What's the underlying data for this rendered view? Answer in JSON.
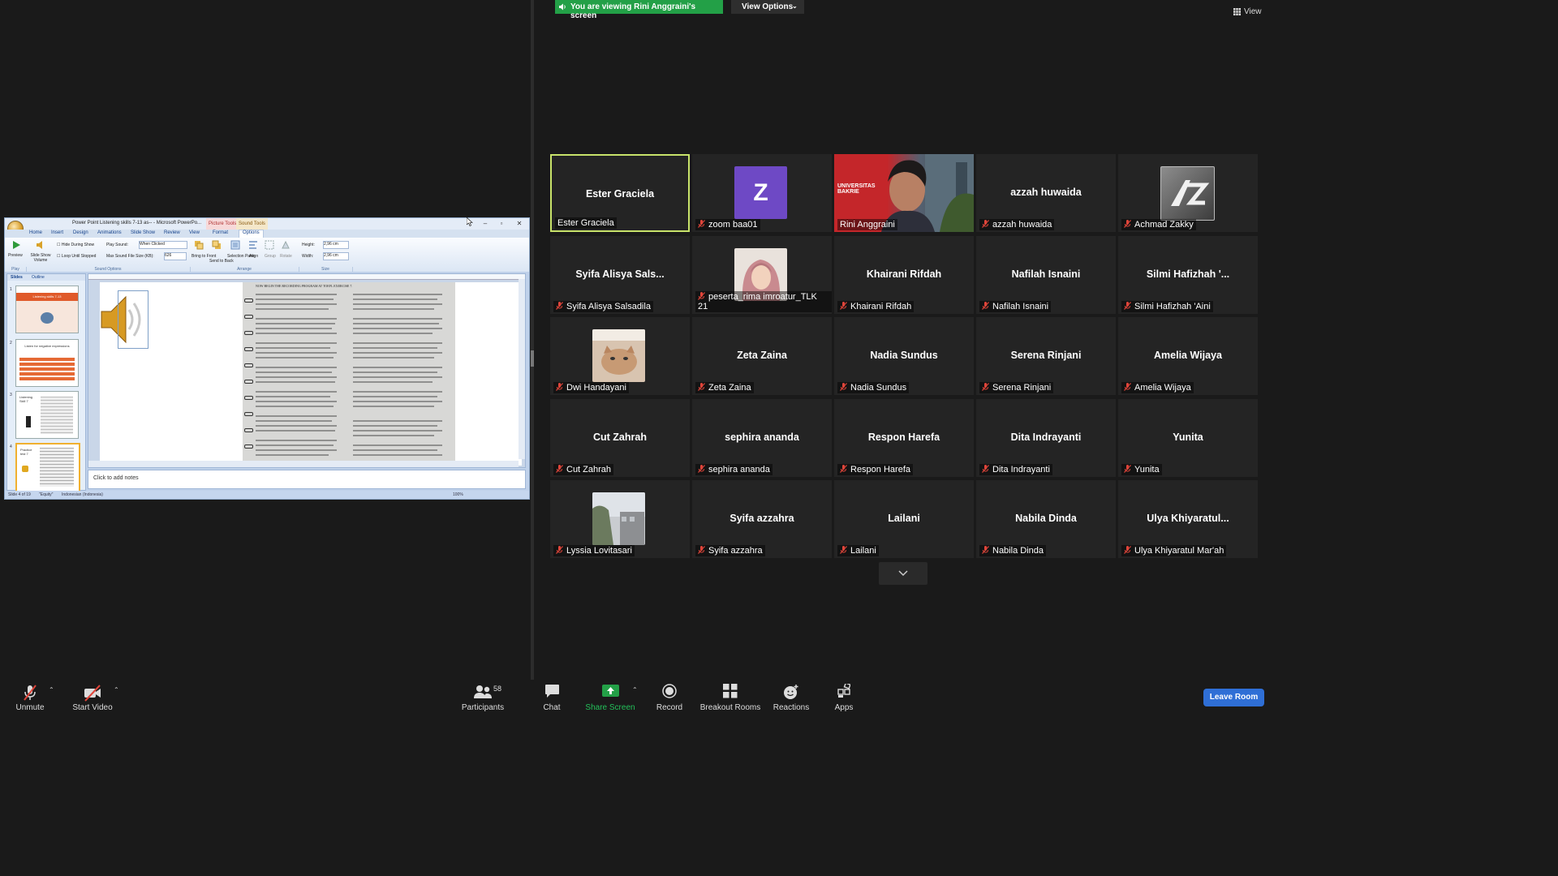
{
  "banner": {
    "text": "You are viewing Rini Anggraini's screen",
    "color": "#23a047"
  },
  "view_options": {
    "label": "View Options",
    "chevron": "⌄"
  },
  "view_button": {
    "label": "View"
  },
  "ppt": {
    "title": "Power Point Listening skills 7-13 as-- - Microsoft PowerPo...",
    "context_tab_1": "Picture Tools",
    "context_tab_2": "Sound Tools",
    "tabs": [
      "Home",
      "Insert",
      "Design",
      "Animations",
      "Slide Show",
      "Review",
      "View",
      "Format",
      "Options"
    ],
    "ribbon": {
      "preview": "Preview",
      "slideshow_volume": "Slide Show Volume",
      "hide_during_show": "Hide During Show",
      "loop_until_stopped": "Loop Until Stopped",
      "play_sound": "Play Sound:",
      "play_sound_value": "When Clicked",
      "max_sound_file_size": "Max Sound File Size (KB):",
      "max_sound_value": "626",
      "bring_to_front": "Bring to Front",
      "send_to_back": "Send to Back",
      "selection_pane": "Selection Pane",
      "align": "Align",
      "group": "Group",
      "rotate": "Rotate",
      "height": "Height:",
      "height_value": "2,96 cm",
      "width": "Width:",
      "width_value": "2,96 cm",
      "group_play": "Play",
      "group_sound_options": "Sound Options",
      "group_arrange": "Arrange",
      "group_size": "Size"
    },
    "panel_tabs": [
      "Slides",
      "Outline"
    ],
    "slide_numbers": [
      "1",
      "2",
      "3",
      "4"
    ],
    "thumb_1_title": "Listening skills 7-13",
    "thumb_2_title": "Listen for negative expressions",
    "thumb_3_title": "Listening Skill 7",
    "thumb_4_title": "Practice test 7",
    "scan_header": "NOW BEGIN THE RECORDING PROGRAM AT TOEFL EXERCISE 7.",
    "notes_placeholder": "Click to add notes",
    "status_slide": "Slide 4 of 19",
    "status_theme": "\"Equity\"",
    "status_lang": "Indonesian (Indonesia)",
    "status_zoom": "100%"
  },
  "participants": [
    {
      "center": "Ester Graciela",
      "label": "Ester Graciela",
      "muted": false,
      "kind": "name",
      "active": true
    },
    {
      "center": "",
      "label": "zoom baa01",
      "muted": true,
      "kind": "avatar",
      "avatar_letter": "Z"
    },
    {
      "center": "",
      "label": "Rini Anggraini",
      "muted": false,
      "kind": "video"
    },
    {
      "center": "azzah huwaida",
      "label": "azzah huwaida",
      "muted": true,
      "kind": "name"
    },
    {
      "center": "",
      "label": "Achmad Zakky",
      "muted": true,
      "kind": "logo"
    },
    {
      "center": "Syifa Alisya Sals...",
      "label": "Syifa Alisya Salsadila",
      "muted": true,
      "kind": "name"
    },
    {
      "center": "",
      "label": "peserta_rima imroatur_TLK 21",
      "muted": true,
      "kind": "photo-hijab"
    },
    {
      "center": "Khairani Rifdah",
      "label": "Khairani Rifdah",
      "muted": true,
      "kind": "name"
    },
    {
      "center": "Nafilah Isnaini",
      "label": "Nafilah Isnaini",
      "muted": true,
      "kind": "name"
    },
    {
      "center": "Silmi Hafizhah '...",
      "label": "Silmi Hafizhah 'Aini",
      "muted": true,
      "kind": "name"
    },
    {
      "center": "",
      "label": "Dwi Handayani",
      "muted": true,
      "kind": "photo-cat"
    },
    {
      "center": "Zeta Zaina",
      "label": "Zeta Zaina",
      "muted": true,
      "kind": "name"
    },
    {
      "center": "Nadia Sundus",
      "label": "Nadia Sundus",
      "muted": true,
      "kind": "name"
    },
    {
      "center": "Serena Rinjani",
      "label": "Serena Rinjani",
      "muted": true,
      "kind": "name"
    },
    {
      "center": "Amelia Wijaya",
      "label": "Amelia Wijaya",
      "muted": true,
      "kind": "name"
    },
    {
      "center": "Cut Zahrah",
      "label": "Cut Zahrah",
      "muted": true,
      "kind": "name"
    },
    {
      "center": "sephira ananda",
      "label": "sephira ananda",
      "muted": true,
      "kind": "name"
    },
    {
      "center": "Respon Harefa",
      "label": "Respon Harefa",
      "muted": true,
      "kind": "name"
    },
    {
      "center": "Dita Indrayanti",
      "label": "Dita Indrayanti",
      "muted": true,
      "kind": "name"
    },
    {
      "center": "Yunita",
      "label": "Yunita",
      "muted": true,
      "kind": "name"
    },
    {
      "center": "",
      "label": "Lyssia Lovitasari",
      "muted": true,
      "kind": "photo-building"
    },
    {
      "center": "Syifa azzahra",
      "label": "Syifa azzahra",
      "muted": true,
      "kind": "name"
    },
    {
      "center": "Lailani",
      "label": "Lailani",
      "muted": true,
      "kind": "name"
    },
    {
      "center": "Nabila Dinda",
      "label": "Nabila Dinda",
      "muted": true,
      "kind": "name"
    },
    {
      "center": "Ulya  Khiyaratul...",
      "label": "Ulya Khiyaratul Mar'ah",
      "muted": true,
      "kind": "name"
    }
  ],
  "video_overlay_text": "UNIVERSITAS BAKRIE",
  "toolbar": {
    "unmute": "Unmute",
    "start_video": "Start Video",
    "participants": "Participants",
    "participants_count": "58",
    "chat": "Chat",
    "share_screen": "Share Screen",
    "record": "Record",
    "breakout_rooms": "Breakout Rooms",
    "reactions": "Reactions",
    "apps": "Apps",
    "leave_room": "Leave Room",
    "caret": "⌃"
  },
  "colors": {
    "share_green": "#23a047",
    "active_border": "#c8e36a",
    "leave_blue": "#2f6fd6",
    "muted_red": "#e0453a",
    "avatar_purple": "#6e49c5"
  }
}
